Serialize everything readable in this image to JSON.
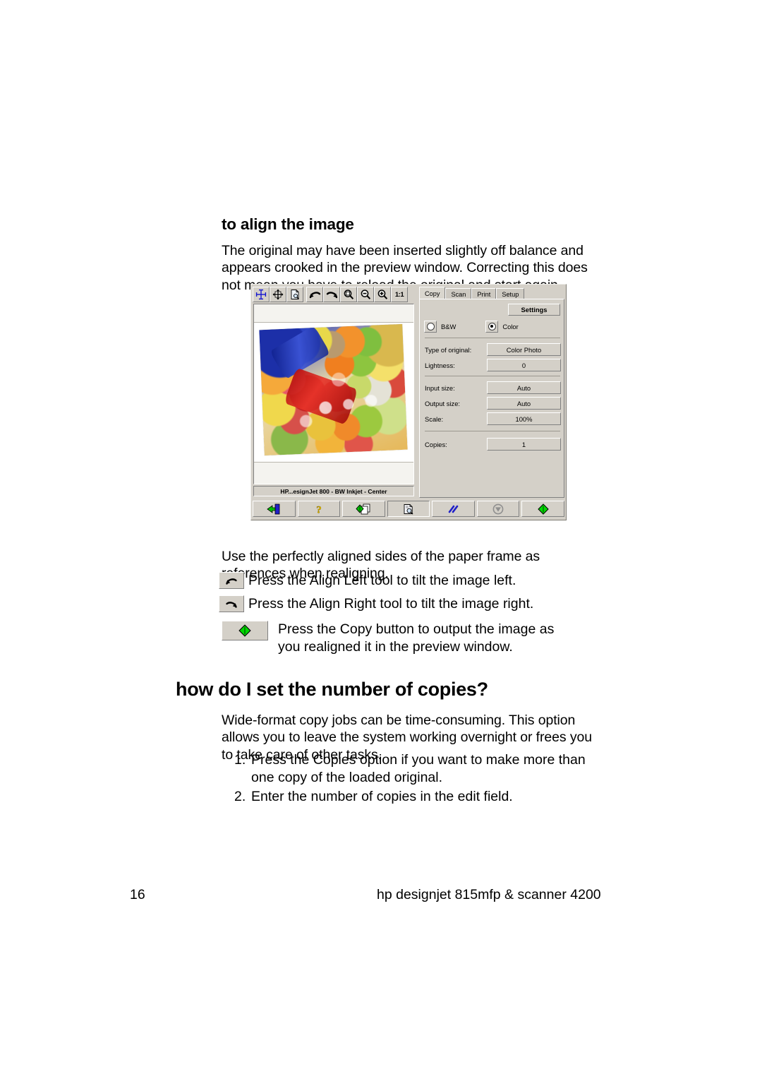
{
  "document": {
    "subheading": "to align the image",
    "intro_paragraph": "The original may have been inserted slightly off balance and appears crooked in the preview window. Correcting this does not mean you have to reload the original and start again.",
    "use_paragraph": "Use the perfectly aligned sides of the paper frame as references when realigning.",
    "bullets": [
      {
        "icon": "align-left-icon",
        "text": "Press the Align Left tool to tilt the image left."
      },
      {
        "icon": "align-right-icon",
        "text": "Press the Align Right tool to tilt the image right."
      },
      {
        "icon": "copy-button-icon",
        "text": "Press the Copy button to output the image as you realigned it in the preview window."
      }
    ],
    "main_heading": "how do I set the number of copies?",
    "body_paragraph": "Wide-format copy jobs can be time-consuming. This option allows you to leave the system working overnight or frees you to take care of other tasks.",
    "steps": [
      {
        "num": "1.",
        "text": "Press the Copies option if you want to make more than one copy of the loaded original."
      },
      {
        "num": "2.",
        "text": "Enter the number of copies in the edit field."
      }
    ]
  },
  "footer": {
    "page_number": "16",
    "product": "hp designjet 815mfp & scanner 4200"
  },
  "scanner_ui": {
    "toolbar": [
      {
        "name": "align-crosshair-icon",
        "title": "Align"
      },
      {
        "name": "move-icon",
        "title": "Move"
      },
      {
        "name": "preview-page-icon",
        "title": "Preview"
      },
      {
        "name": "align-left-icon",
        "title": "Align Left"
      },
      {
        "name": "align-right-icon",
        "title": "Align Right"
      },
      {
        "name": "zoom-fit-icon",
        "title": "Zoom to fit"
      },
      {
        "name": "zoom-out-icon",
        "title": "Zoom out"
      },
      {
        "name": "zoom-in-icon",
        "title": "Zoom in"
      },
      {
        "name": "zoom-one-to-one-icon",
        "label": "1:1",
        "title": "1:1"
      }
    ],
    "status_text": "HP...esignJet 800 - BW Inkjet - Center",
    "tabs": [
      {
        "label": "Copy",
        "active": true
      },
      {
        "label": "Scan",
        "active": false
      },
      {
        "label": "Print",
        "active": false
      },
      {
        "label": "Setup",
        "active": false
      }
    ],
    "settings_label": "Settings",
    "color_mode": {
      "bw_label": "B&W",
      "color_label": "Color",
      "selected": "Color"
    },
    "fields": [
      {
        "label": "Type of original:",
        "value": "Color Photo"
      },
      {
        "label": "Lightness:",
        "value": "0"
      },
      {
        "label": "Input size:",
        "value": "Auto"
      },
      {
        "label": "Output size:",
        "value": "Auto"
      },
      {
        "label": "Scale:",
        "value": "100%"
      },
      {
        "label": "Copies:",
        "value": "1"
      }
    ],
    "bottom_buttons": [
      {
        "name": "exit-icon",
        "title": "Exit",
        "state": "normal"
      },
      {
        "name": "help-icon",
        "title": "Help",
        "state": "normal"
      },
      {
        "name": "copy-to-file-icon",
        "title": "Copy to file",
        "state": "normal"
      },
      {
        "name": "preview-icon",
        "title": "Preview",
        "state": "pressed"
      },
      {
        "name": "reset-icon",
        "title": "Reset",
        "state": "normal"
      },
      {
        "name": "stop-icon",
        "title": "Stop",
        "state": "disabled"
      },
      {
        "name": "copy-icon",
        "title": "Copy",
        "state": "normal"
      }
    ],
    "colors": {
      "window_face": "#d4d0c8",
      "green": "#00c000",
      "blue": "#0000c0",
      "yellow": "#e8c000",
      "gray_disabled": "#909090"
    }
  }
}
